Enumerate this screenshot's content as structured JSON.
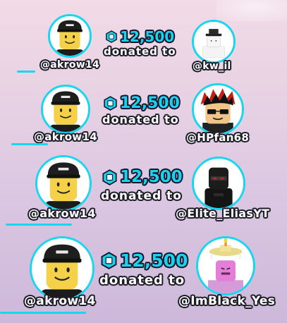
{
  "accent_color": "#19d6f0",
  "currency_icon": "robux-icon",
  "donations": [
    {
      "donor": "@akrow14",
      "amount": "12,500",
      "label": "donated to",
      "recipient": "@kw_il"
    },
    {
      "donor": "@akrow14",
      "amount": "12,500",
      "label": "donated to",
      "recipient": "@HPfan68"
    },
    {
      "donor": "@akrow14",
      "amount": "12,500",
      "label": "donated to",
      "recipient": "@Elite_EliasYT"
    },
    {
      "donor": "@akrow14",
      "amount": "12,500",
      "label": "donated to",
      "recipient": "@ImBlack_Yes"
    }
  ]
}
